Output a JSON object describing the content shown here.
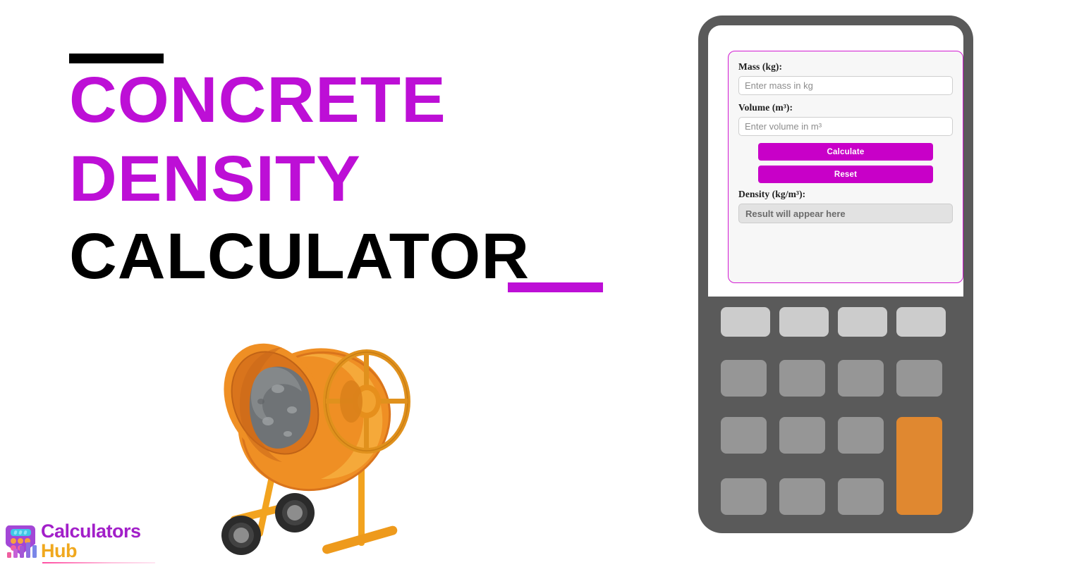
{
  "page": {
    "background_color": "#ffffff",
    "accent_purple": "#bd0fd6",
    "button_purple": "#c800c8",
    "device_gray": "#5a5a5a",
    "key_light_gray": "#cccccc",
    "key_mid_gray": "#969696",
    "key_accent_orange": "#e08830"
  },
  "title": {
    "line1": "Concrete",
    "line2": "Density",
    "line3": "Calculator",
    "line1_color": "#bd0fd6",
    "line2_color": "#bd0fd6",
    "line3_color": "#000000",
    "top_rule_color": "#000000",
    "bottom_rule_color": "#bd0fd6"
  },
  "illustration": {
    "name": "cement-mixer",
    "drum_color": "#ef8f24",
    "drum_shade_color": "#d9741c",
    "drum_highlight_color": "#f5a93a",
    "concrete_color": "#6f7376",
    "frame_color": "#f2a31f",
    "wheel_color": "#2b2b2b"
  },
  "logo": {
    "word1": "Calculators",
    "word2": "Hub",
    "word1_color": "#a21fc9",
    "word2_color": "#f0a81e",
    "icon_name": "calculator-bar-chart-icon"
  },
  "calculator": {
    "form": {
      "mass": {
        "label": "Mass (kg):",
        "placeholder": "Enter mass in kg",
        "value": ""
      },
      "volume": {
        "label": "Volume (m³):",
        "placeholder": "Enter volume in m³",
        "value": ""
      },
      "calculate_label": "Calculate",
      "reset_label": "Reset",
      "result": {
        "label": "Density (kg/m³):",
        "text": "Result will appear here"
      }
    },
    "keypad": {
      "rows": 4,
      "columns": 4,
      "top_row_style": "light",
      "accent_key_position": "column-4-rows-3-4"
    }
  }
}
